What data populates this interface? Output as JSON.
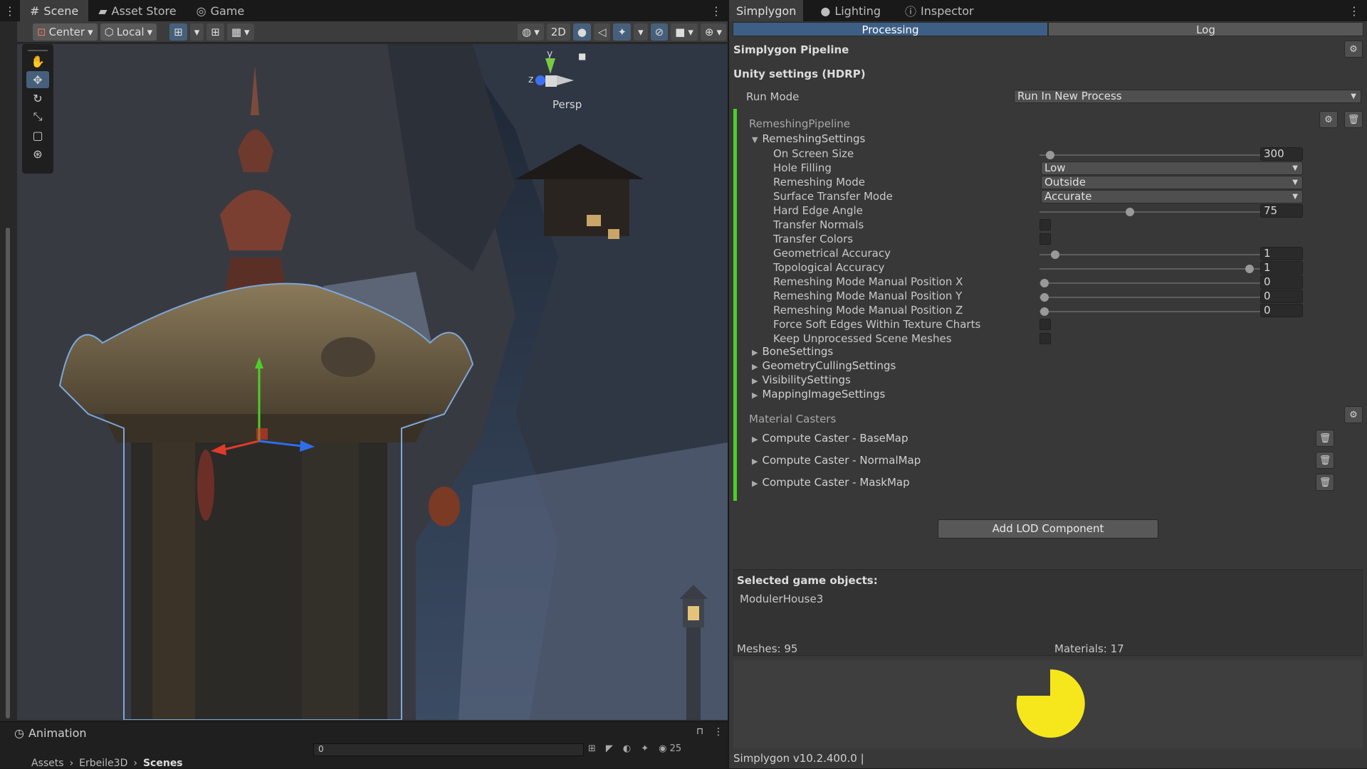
{
  "scene_tabs": [
    {
      "label": "Scene",
      "icon": "grid-icon"
    },
    {
      "label": "Asset Store",
      "icon": "bag-icon"
    },
    {
      "label": "Game",
      "icon": "gamepad-icon"
    }
  ],
  "toolbar": {
    "pivot": "Center",
    "space": "Local",
    "twod": "2D"
  },
  "viewport": {
    "persp_label": "Persp",
    "gizmo_y": "y",
    "gizmo_z": "z"
  },
  "animation": {
    "title": "Animation",
    "frame": "0",
    "breadcrumb": [
      "Assets",
      "Erbeile3D",
      "Scenes"
    ],
    "count": "25"
  },
  "right_tabs": [
    {
      "label": "Simplygon",
      "icon": ""
    },
    {
      "label": "Lighting",
      "icon": "bulb-icon"
    },
    {
      "label": "Inspector",
      "icon": "info-icon"
    }
  ],
  "sub_tabs": {
    "processing": "Processing",
    "log": "Log"
  },
  "pipeline": {
    "title": "Simplygon Pipeline",
    "unity_settings": "Unity settings (HDRP)",
    "run_mode_label": "Run Mode",
    "run_mode_value": "Run In New Process",
    "remeshing_pipeline": "RemeshingPipeline",
    "remeshing_settings": "RemeshingSettings"
  },
  "settings": {
    "on_screen_size": {
      "label": "On Screen Size",
      "value": "300"
    },
    "hole_filling": {
      "label": "Hole Filling",
      "value": "Low"
    },
    "remeshing_mode": {
      "label": "Remeshing Mode",
      "value": "Outside"
    },
    "surface_transfer_mode": {
      "label": "Surface Transfer Mode",
      "value": "Accurate"
    },
    "hard_edge_angle": {
      "label": "Hard Edge Angle",
      "value": "75"
    },
    "transfer_normals": {
      "label": "Transfer Normals"
    },
    "transfer_colors": {
      "label": "Transfer Colors"
    },
    "geometrical_accuracy": {
      "label": "Geometrical Accuracy",
      "value": "1"
    },
    "topological_accuracy": {
      "label": "Topological Accuracy",
      "value": "1"
    },
    "pos_x": {
      "label": "Remeshing Mode Manual Position X",
      "value": "0"
    },
    "pos_y": {
      "label": "Remeshing Mode Manual Position Y",
      "value": "0"
    },
    "pos_z": {
      "label": "Remeshing Mode Manual Position Z",
      "value": "0"
    },
    "force_soft_edges": {
      "label": "Force Soft Edges Within Texture Charts"
    },
    "keep_unprocessed": {
      "label": "Keep Unprocessed Scene Meshes"
    }
  },
  "foldouts": [
    "BoneSettings",
    "GeometryCullingSettings",
    "VisibilitySettings",
    "MappingImageSettings"
  ],
  "material_casters": {
    "title": "Material Casters",
    "items": [
      "Compute Caster - BaseMap",
      "Compute Caster - NormalMap",
      "Compute Caster - MaskMap"
    ]
  },
  "add_lod_button": "Add LOD Component",
  "selection": {
    "title": "Selected game objects:",
    "object": "ModulerHouse3",
    "meshes": "Meshes: 95",
    "materials": "Materials: 17"
  },
  "footer": {
    "version": "Simplygon v10.2.400.0 |",
    "logo_color": "#f5e71c"
  },
  "colors": {
    "accent_green": "#4ccf28",
    "selected_tab": "#3d5f85",
    "logo": "#f5e71c"
  }
}
